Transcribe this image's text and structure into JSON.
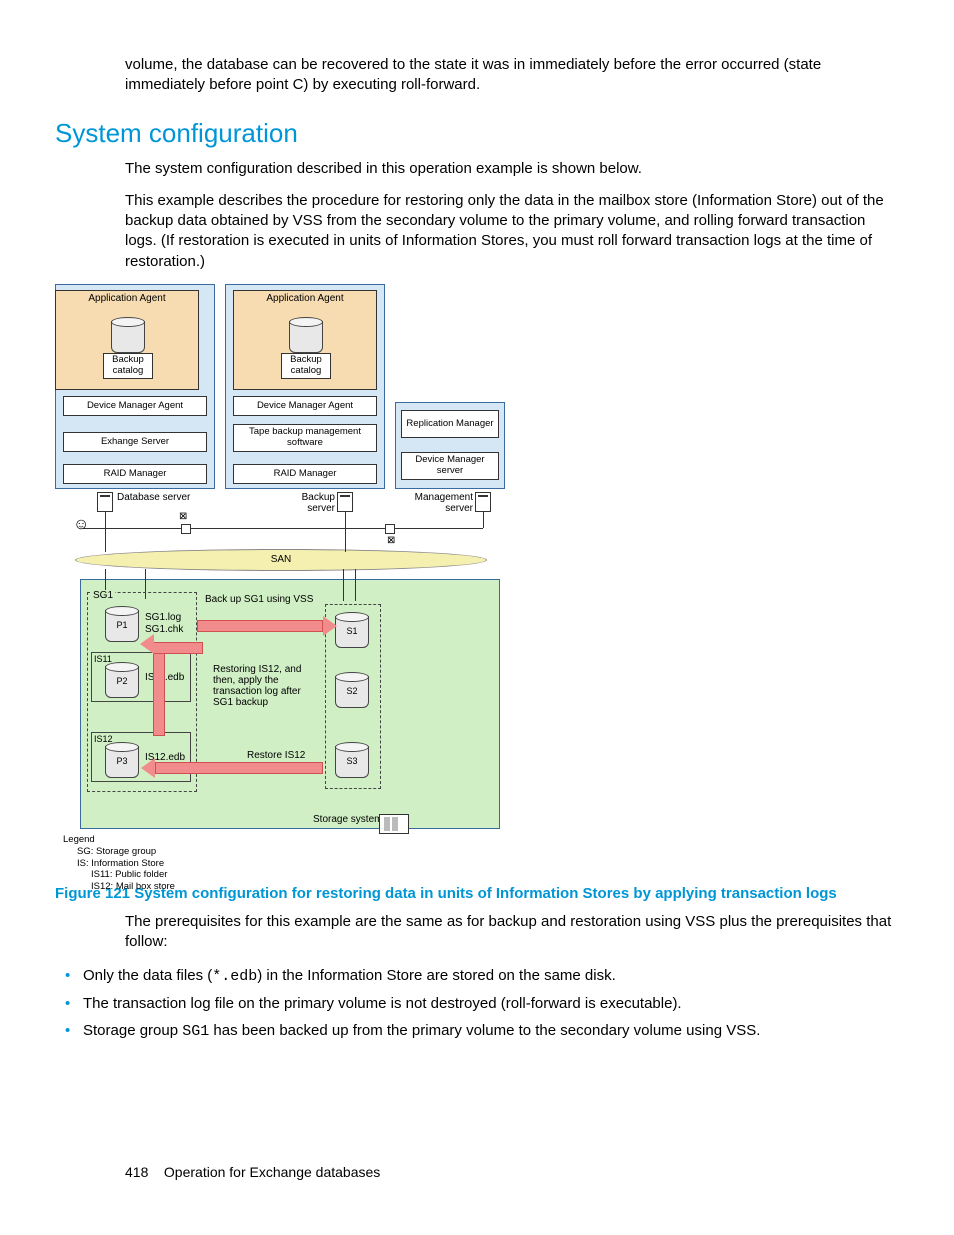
{
  "intro_paragraph": "volume, the database can be recovered to the state it was in immediately before the error occurred (state immediately before point C) by executing roll-forward.",
  "heading": "System configuration",
  "para1": "The system configuration described in this operation example is shown below.",
  "para2": "This example describes the procedure for restoring only the data in the mailbox store (Information Store) out of the backup data obtained by VSS from the secondary volume to the primary volume, and rolling forward transaction logs. (If restoration is executed in units of Information Stores, you must roll forward transaction logs at the time of restoration.)",
  "diagram": {
    "app_agent": "Application Agent",
    "backup_catalog": "Backup catalog",
    "dev_mgr_agent": "Device Manager Agent",
    "exchange_server": "Exhange Server",
    "tape_backup": "Tape backup management software",
    "raid_mgr": "RAID Manager",
    "repl_mgr": "Replication Manager",
    "dev_mgr_server": "Device Manager server",
    "db_server": "Database server",
    "backup_server": "Backup server",
    "mgmt_server": "Management server",
    "san": "SAN",
    "sg1": "SG1",
    "sg1_log": "SG1.log",
    "sg1_chk": "SG1.chk",
    "is11_label": "IS11",
    "is11_edb": "IS11.edb",
    "is12_label": "IS12",
    "is12_edb": "IS12.edb",
    "backup_sg1": "Back up SG1 using VSS",
    "restore_text": "Restoring IS12, and then, apply the transaction log after SG1 backup",
    "restore_is12": "Restore IS12",
    "storage_system": "Storage system",
    "p1": "P1",
    "p2": "P2",
    "p3": "P3",
    "s1": "S1",
    "s2": "S2",
    "s3": "S3",
    "legend_title": "Legend",
    "legend": {
      "sg": "SG: Storage group",
      "is": "IS: Information Store",
      "is11": "IS11: Public folder",
      "is12": "IS12: Mail box store"
    }
  },
  "figure_caption": "Figure 121 System configuration for restoring data in units of Information Stores by applying transaction logs",
  "para3": "The prerequisites for this example are the same as for backup and restoration using VSS plus the prerequisites that follow:",
  "bullets": {
    "b1a": "Only the data files (",
    "b1_code": "*.edb",
    "b1b": ") in the Information Store are stored on the same disk.",
    "b2": "The transaction log file on the primary volume is not destroyed (roll-forward is executable).",
    "b3a": "Storage group ",
    "b3_code": "SG1",
    "b3b": " has been backed up from the primary volume to the secondary volume using VSS."
  },
  "footer": {
    "page_num": "418",
    "section": "Operation for Exchange databases"
  }
}
